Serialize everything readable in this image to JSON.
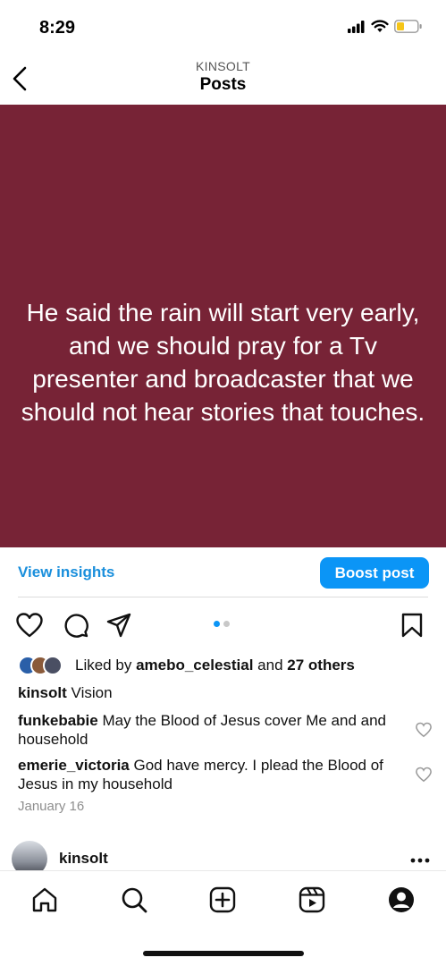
{
  "status_bar": {
    "time": "8:29"
  },
  "header": {
    "subtitle": "KINSOLT",
    "title": "Posts"
  },
  "post": {
    "background_color": "#772336",
    "text": "He said the rain will start very early, and we should pray for a Tv presenter and broadcaster that we should not hear stories that touches."
  },
  "insights": {
    "view_label": "View insights",
    "boost_label": "Boost post"
  },
  "carousel": {
    "total": 2,
    "active_index": 0
  },
  "likes": {
    "prefix": "Liked by",
    "user": "amebo_celestial",
    "connector": "and",
    "others": "27 others"
  },
  "caption": {
    "user": "kinsolt",
    "text": "Vision"
  },
  "comments": [
    {
      "user": "funkebabie",
      "text": "May the Blood of Jesus cover Me and and household"
    },
    {
      "user": "emerie_victoria",
      "text": "God have mercy. I plead the Blood of Jesus in my household"
    }
  ],
  "date": "January 16",
  "next_post": {
    "user": "kinsolt"
  },
  "tabs": [
    "home-icon",
    "search-icon",
    "create-icon",
    "reels-icon",
    "profile-icon"
  ],
  "colors": {
    "accent": "#0b95f6",
    "link": "#1a8fdc"
  }
}
